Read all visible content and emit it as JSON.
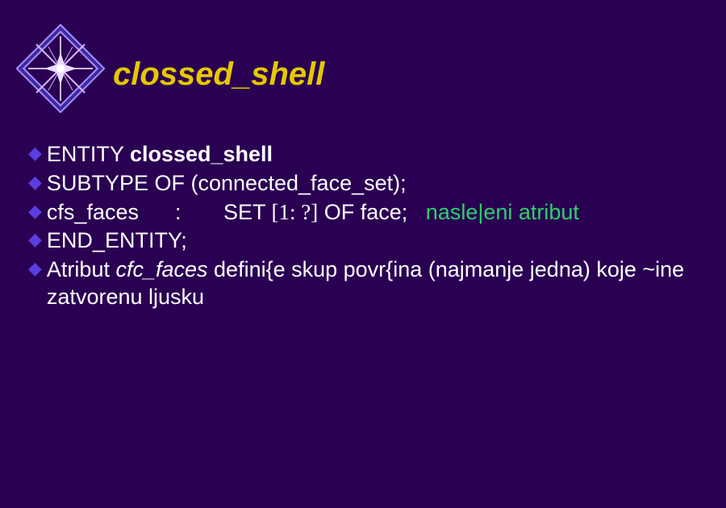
{
  "title": "clossed_shell",
  "bullets": [
    {
      "pre": "ENTITY ",
      "bold": "clossed_shell"
    },
    {
      "pre": "SUBTYPE OF (connected_face_set);"
    },
    {
      "pre": "cfs_faces      :       SET ",
      "serif": "[1: ?]",
      "post": " OF face;   ",
      "green": "nasle|eni atribut"
    },
    {
      "pre": "END_ENTITY;"
    },
    {
      "pre": "Atribut ",
      "italic": "cfc_faces",
      "post": " defini{e skup povr{ina (najmanje jedna) koje ~ine zatvorenu ljusku"
    }
  ]
}
